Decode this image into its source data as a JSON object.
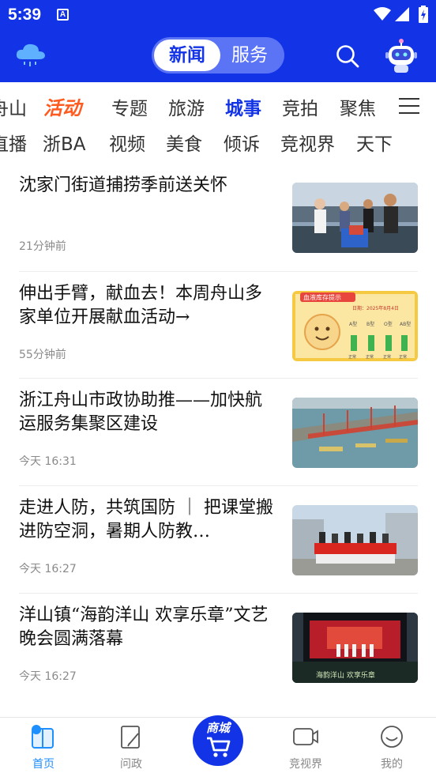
{
  "status_bar": {
    "time": "5:39",
    "sim_label": "A"
  },
  "header": {
    "segment": {
      "active": "新闻",
      "inactive": "服务"
    }
  },
  "tabs": {
    "row1": [
      "舟山",
      "活动",
      "专题",
      "旅游",
      "城事",
      "竞拍",
      "聚焦"
    ],
    "row2": [
      "直播",
      "浙BA",
      "视频",
      "美食",
      "倾诉",
      "竞视界",
      "天下"
    ],
    "active": "城事",
    "highlight": "活动"
  },
  "news": [
    {
      "title": "沈家门街道捕捞季前送关怀",
      "time": "21分钟前",
      "thumb": "people-on-boat-photo"
    },
    {
      "title": "伸出手臂，献血去！本周舟山多家单位开展献血活动→",
      "time": "55分钟前",
      "thumb": "blood-stock-poster",
      "thumb_text": {
        "heading": "血液库存提示",
        "date": "日期：2025年8月4日",
        "groups": [
          "A型",
          "B型",
          "O型",
          "AB型"
        ],
        "status": [
          "正常",
          "正常",
          "正常",
          "正常"
        ]
      }
    },
    {
      "title": "浙江舟山市政协助推——加快航运服务集聚区建设",
      "time": "今天  16:31",
      "thumb": "shipyard-aerial-photo"
    },
    {
      "title": "走进人防，共筑国防 ｜ 把课堂搬进防空洞，暑期人防教…",
      "time": "今天  16:27",
      "thumb": "group-photo-banner"
    },
    {
      "title": "洋山镇“海韵洋山 欢享乐章”文艺晚会圆满落幕",
      "time": "今天  16:27",
      "thumb": "stage-performance-photo",
      "thumb_text": {
        "stage_caption": "海韵洋山 欢享乐章"
      }
    }
  ],
  "bottom_nav": {
    "items": [
      {
        "label": "首页",
        "icon": "home-icon",
        "active": true
      },
      {
        "label": "问政",
        "icon": "edit-doc-icon",
        "active": false
      },
      {
        "label": "竞视界",
        "icon": "video-icon",
        "active": false
      },
      {
        "label": "我的",
        "icon": "smile-icon",
        "active": false
      }
    ],
    "center_label": "商城"
  },
  "colors": {
    "brand_blue": "#1233e6",
    "activity_orange": "#ff5a1f",
    "nav_active": "#1e8fff"
  }
}
